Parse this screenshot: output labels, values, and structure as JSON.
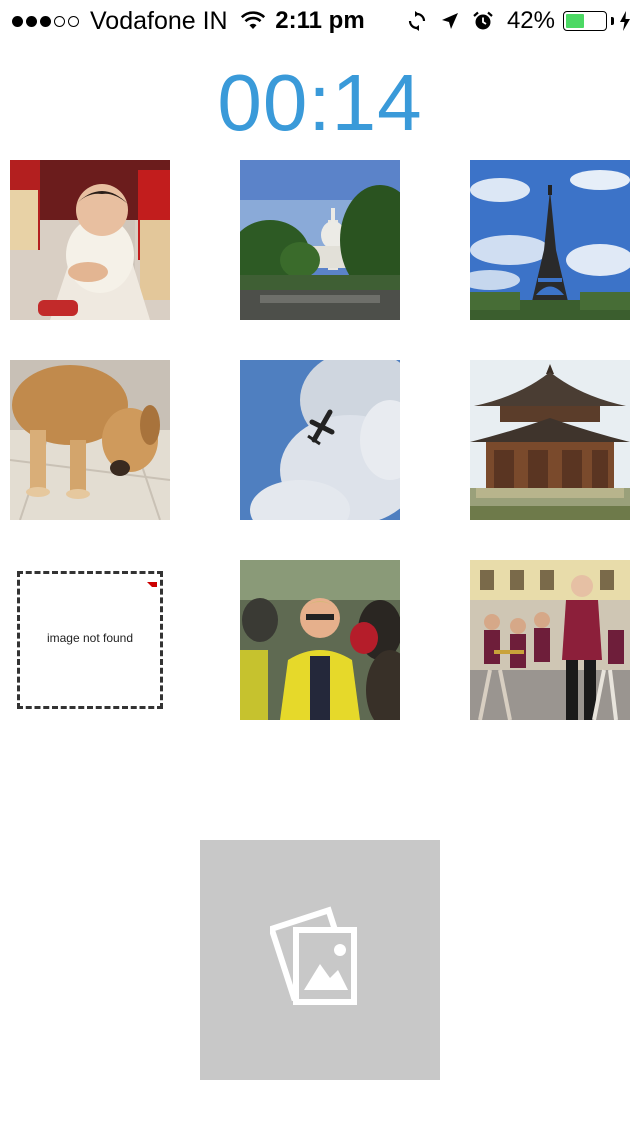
{
  "status_bar": {
    "carrier": "Vodafone IN",
    "signal_bars_filled": 3,
    "signal_bars_total": 5,
    "time": "2:11 pm",
    "battery_percent": "42%",
    "battery_level": 0.42,
    "icons": [
      "wifi-icon",
      "rotation-lock-icon",
      "location-icon",
      "alarm-icon",
      "battery-icon",
      "charging-bolt-icon"
    ]
  },
  "timer": {
    "value": "00:14",
    "color": "#3a9ad9"
  },
  "grid": {
    "tiles": [
      {
        "subject": "baby sitting on floor"
      },
      {
        "subject": "capitol building"
      },
      {
        "subject": "eiffel tower"
      },
      {
        "subject": "dog sniffing floor"
      },
      {
        "subject": "airplane in sky"
      },
      {
        "subject": "pagoda temple"
      },
      {
        "subject": "image not found",
        "label": "image not found"
      },
      {
        "subject": "man in yellow jacket in crowd"
      },
      {
        "subject": "brass band performing"
      }
    ]
  },
  "placeholder": {
    "icon": "image-placeholder-icon",
    "background": "#c8c8c8"
  }
}
